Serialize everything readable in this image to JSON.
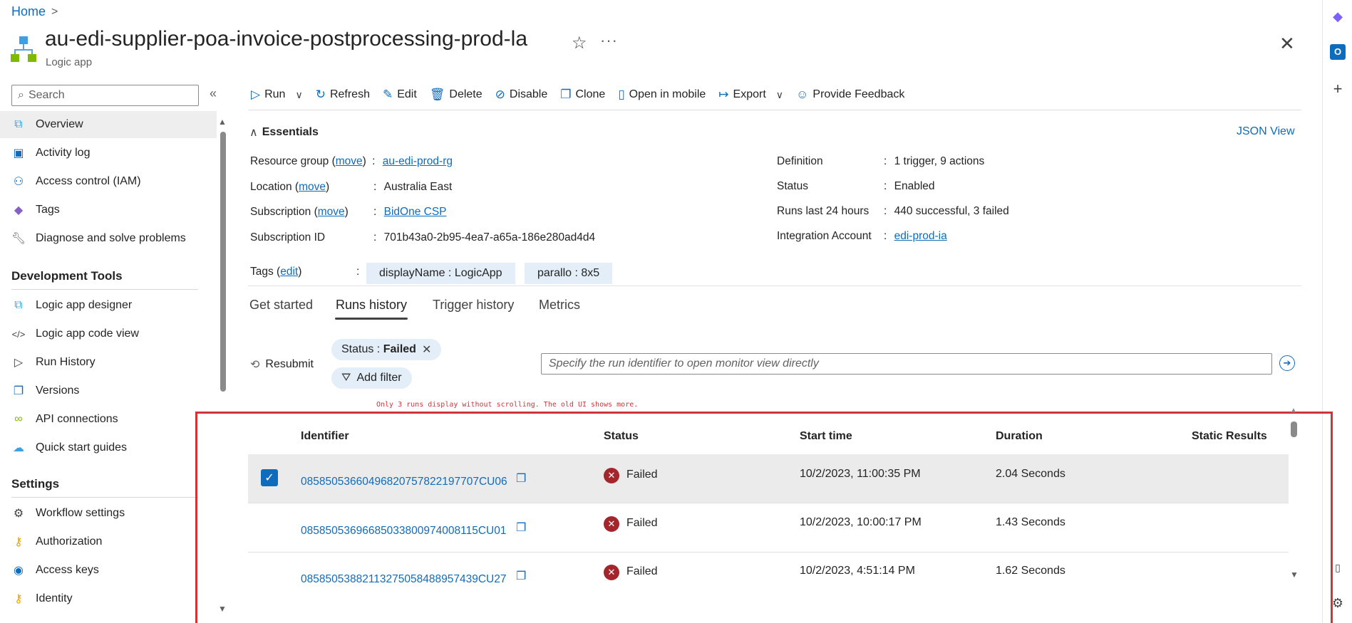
{
  "breadcrumb": {
    "home": "Home",
    "separator": ">"
  },
  "header": {
    "title": "au-edi-supplier-poa-invoice-postprocessing-prod-la",
    "subtitle": "Logic app",
    "more": "···"
  },
  "sidebar": {
    "search_placeholder": "Search",
    "top_items": [
      {
        "label": "Overview",
        "icon": "logic-app-icon"
      },
      {
        "label": "Activity log",
        "icon": "activity-log-icon"
      },
      {
        "label": "Access control (IAM)",
        "icon": "people-icon"
      },
      {
        "label": "Tags",
        "icon": "tag-icon"
      },
      {
        "label": "Diagnose and solve problems",
        "icon": "wrench-icon"
      }
    ],
    "dev_heading": "Development Tools",
    "dev_items": [
      {
        "label": "Logic app designer",
        "icon": "designer-icon"
      },
      {
        "label": "Logic app code view",
        "icon": "code-icon"
      },
      {
        "label": "Run History",
        "icon": "run-history-icon"
      },
      {
        "label": "Versions",
        "icon": "versions-icon"
      },
      {
        "label": "API connections",
        "icon": "link-icon"
      },
      {
        "label": "Quick start guides",
        "icon": "cloud-icon"
      }
    ],
    "settings_heading": "Settings",
    "settings_items": [
      {
        "label": "Workflow settings",
        "icon": "gear-icon"
      },
      {
        "label": "Authorization",
        "icon": "key-icon"
      },
      {
        "label": "Access keys",
        "icon": "globe-icon"
      },
      {
        "label": "Identity",
        "icon": "identity-key-icon"
      }
    ]
  },
  "toolbar": {
    "run": "Run",
    "refresh": "Refresh",
    "edit": "Edit",
    "delete": "Delete",
    "disable": "Disable",
    "clone": "Clone",
    "open_mobile": "Open in mobile",
    "export": "Export",
    "feedback": "Provide Feedback"
  },
  "essentials": {
    "heading": "Essentials",
    "json_view": "JSON View",
    "resource_group_key": "Resource group",
    "move": "move",
    "resource_group_val": "au-edi-prod-rg",
    "location_key": "Location",
    "location_val": "Australia East",
    "subscription_key": "Subscription",
    "subscription_val": "BidOne CSP",
    "subscription_id_key": "Subscription ID",
    "subscription_id_val": "701b43a0-2b95-4ea7-a65a-186e280ad4d4",
    "definition_key": "Definition",
    "definition_val": "1 trigger, 9 actions",
    "status_key": "Status",
    "status_val": "Enabled",
    "runs_key": "Runs last 24 hours",
    "runs_val": "440 successful, 3 failed",
    "integration_key": "Integration Account",
    "integration_val": "edi-prod-ia",
    "tags_key": "Tags",
    "edit": "edit",
    "tag1": "displayName : LogicApp",
    "tag2": "parallo : 8x5",
    "colon": ":"
  },
  "tabs": [
    "Get started",
    "Runs history",
    "Trigger history",
    "Metrics"
  ],
  "filters": {
    "resubmit": "Resubmit",
    "status_key": "Status : ",
    "status_val": "Failed",
    "add_filter": "Add filter",
    "run_placeholder": "Specify the run identifier to open monitor view directly",
    "note": "Only 3 runs display without scrolling. The old UI shows more."
  },
  "table": {
    "headers": [
      "Identifier",
      "Status",
      "Start time",
      "Duration",
      "Static Results"
    ],
    "rows": [
      {
        "id": "08585053660496820757822197707CU06",
        "status": "Failed",
        "start": "10/2/2023, 11:00:35 PM",
        "duration": "2.04 Seconds"
      },
      {
        "id": "08585053696685033800974008115CU01",
        "status": "Failed",
        "start": "10/2/2023, 10:00:17 PM",
        "duration": "1.43 Seconds"
      },
      {
        "id": "08585053882113275058488957439CU27",
        "status": "Failed",
        "start": "10/2/2023, 4:51:14 PM",
        "duration": "1.62 Seconds"
      }
    ]
  },
  "colors": {
    "accent": "#0f6cbd",
    "failed": "#a4262c",
    "annotation": "#d13438"
  }
}
